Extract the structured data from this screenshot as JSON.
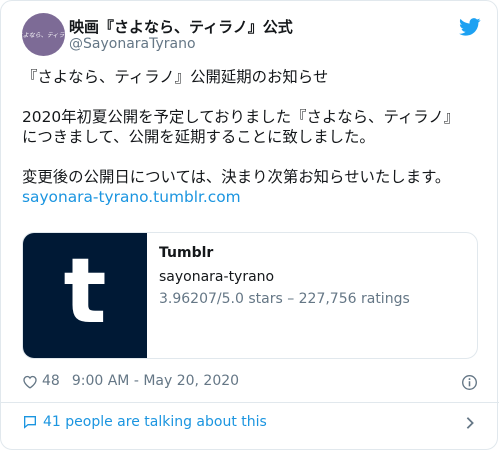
{
  "author": {
    "avatar_text": "さよなら、ティラノ",
    "name": "映画『さよなら、ティラノ』公式",
    "handle": "@SayonaraTyrano"
  },
  "tweet": {
    "line1": "『さよなら、ティラノ』公開延期のお知らせ",
    "line2": "2020年初夏公開を予定しておりました『さよなら、ティラノ』",
    "line3": "につきまして、公開を延期することに致しました。",
    "line4": "変更後の公開日については、決まり次第お知らせいたします。",
    "link": "sayonara-tyrano.tumblr.com"
  },
  "preview": {
    "logo_letter": "t",
    "title": "Tumblr",
    "domain": "sayonara-tyrano",
    "description": "3.96207/5.0 stars – 227,756 ratings"
  },
  "meta": {
    "likes": "48",
    "timestamp": "9:00 AM - May 20, 2020"
  },
  "footer": {
    "talking": "41 people are talking about this"
  },
  "colors": {
    "link": "#1b95e0",
    "twitter_blue": "#1da1f2",
    "tumblr_bg": "#001935"
  },
  "icons": {
    "twitter": "twitter-bird-icon",
    "heart": "heart-icon",
    "info": "info-icon",
    "chat": "chat-bubble-icon",
    "chevron": "chevron-right-icon"
  }
}
